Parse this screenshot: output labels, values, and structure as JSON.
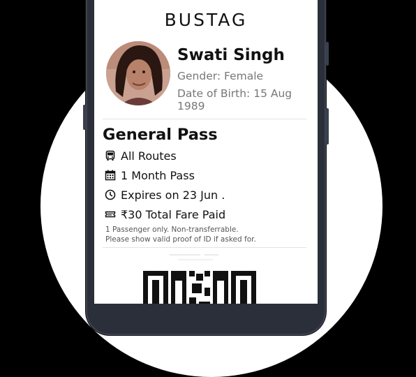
{
  "app": {
    "brand": "BUSTAG"
  },
  "profile": {
    "name": "Swati Singh",
    "gender": "Gender: Female",
    "dob": "Date of Birth: 15 Aug 1989",
    "avatar_icon": "profile-photo"
  },
  "pass": {
    "title": "General Pass",
    "items": [
      {
        "icon": "bus-icon",
        "label": "All Routes"
      },
      {
        "icon": "calendar-icon",
        "label": "1 Month Pass"
      },
      {
        "icon": "clock-icon",
        "label": "Expires on 23 Jun ."
      },
      {
        "icon": "ticket-icon",
        "label": "₹30 Total Fare Paid"
      }
    ],
    "note_line1": "1 Passenger only. Non-transferrable.",
    "note_line2": "Please show valid proof of ID if asked for."
  },
  "colors": {
    "background": "#000000",
    "phone_frame": "#2b2f3a",
    "text": "#111111",
    "muted": "#777777"
  }
}
